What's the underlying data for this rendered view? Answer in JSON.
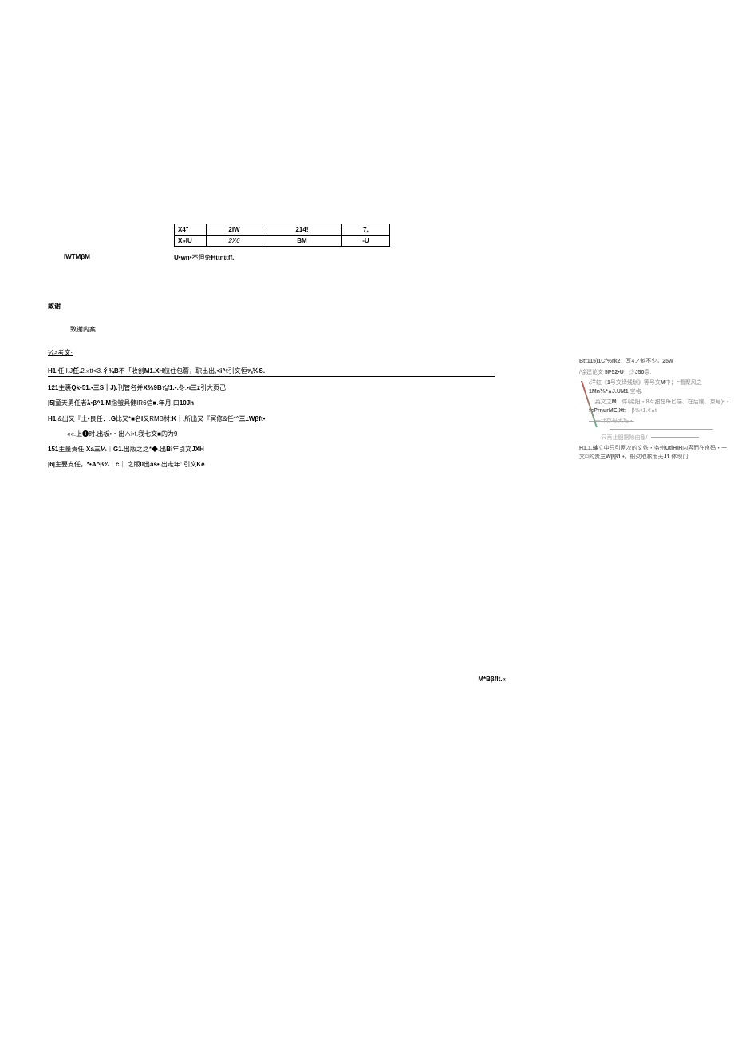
{
  "table": {
    "rows": [
      {
        "head": "X4\"",
        "c1": "2IW",
        "c2": "214!",
        "c3": "7,"
      },
      {
        "head": "X»IU",
        "c1": "2X6",
        "c2": "BM",
        "c3": "-U"
      }
    ]
  },
  "caption": {
    "left": "IWTMβM",
    "right_bold": "U•wn•",
    "right_norm": "不但杂",
    "right_bold2": "Httnttff."
  },
  "ack": {
    "title": "致谢",
    "body": "致谢内案"
  },
  "refs_title": "⅟₆>考文·",
  "refs": [
    {
      "ul": true,
      "parts": [
        "H1.",
        "任.I.J",
        "任.",
        "2.»tt<3.",
        "彳¾B",
        "不「收创",
        "M1.XH",
        "位住包簷，职出出,",
        "<i^t",
        "引文恒",
        "⅝⅟₆S."
      ]
    },
    {
      "ul": false,
      "parts": [
        "121",
        "主裹",
        "Qk•51.•三S｜J).",
        "刊管名并",
        "X⅗9B⅞f1.•.",
        "冬.",
        "•ι三z",
        "引大页己"
      ]
    },
    {
      "ul": false,
      "parts": [
        "|5|",
        "童天勇任者",
        "λ•β^1.M",
        "指皱具健IR6",
        "信■.年月.曰",
        "10Jh"
      ]
    },
    {
      "ul": false,
      "parts": [
        "H1.",
        "&出又『土•良任．.",
        "G",
        "比又*■名",
        "I",
        "又RMB材:",
        "K",
        "｜.所出又『冥修&任*^",
        "三±Wβft•"
      ]
    },
    {
      "ul": false,
      "parts": [
        "««.上❶时.出板•・出∧i•t.我七文■的为9"
      ]
    },
    {
      "ul": false,
      "parts": [
        "151",
        "主量责任·",
        "Xa三⅟₆",
        "｜",
        "G1.",
        "出版之之*◆.出",
        "Bi",
        "年引文",
        "JXH"
      ]
    },
    {
      "ul": false,
      "parts": [
        "|6|",
        "主要支任，",
        "*•A^β¾",
        "｜",
        "c",
        "｜.之版",
        "0",
        "出",
        "as•.",
        "出走年:  引文",
        "Ke"
      ]
    }
  ],
  "side_note": "M*Bβflt.«",
  "annotations": [
    {
      "type": "line",
      "cls": "dark",
      "html": "<span class='hl1'>Btt115)1Cf%rk2</span>：写4之魁不少，<span class='hl1'>25w</span>"
    },
    {
      "type": "line",
      "cls": "",
      "html": "/徐建论文 <span class='hl2'>5P52•U</span>，少<span class='hl2'>J50</span>条."
    },
    {
      "type": "slash-start"
    },
    {
      "type": "line",
      "cls": "",
      "html": "/洋虹《<span class='hl2'>1</span>号文绿线划》等号文<span class='hl2'>M</span>中；=看聚风之<span class='hl2'>1Mn⅟₆*∧J.UM1.</span>空格."
    },
    {
      "type": "line",
      "cls": "",
      "html": "&nbsp;&nbsp;&nbsp;&nbsp;英文之<span class='hl2'>M</span>：件/梁阳・8々甜在8•匕端、在后耀、京号)•・<span class='hl2'>fcPrnurME.Xtt</span>｜β⅝<1.•!∧t"
    },
    {
      "type": "line",
      "cls": "struck",
      "html": "&nbsp;&nbsp;&nbsp;&nbsp;一计存母犬巧・"
    },
    {
      "type": "blankline"
    },
    {
      "type": "line",
      "cls": "blank-line2",
      "html": "&nbsp;&nbsp;&nbsp;&nbsp;&nbsp;&nbsp;&nbsp;&nbsp;只再止肥需除由鱼/<span class='fill'></span>"
    },
    {
      "type": "slash-end"
    },
    {
      "type": "line",
      "cls": "dark",
      "html": "<span class='hl1'>H1.1.</span><span class='hl2'>轴</span>立中只引两次的文依・务州<span class='hl2'>UtiHIH</span>内容而在良码・一文©的贵<span class='hl2'>三Wββ1.•</span>，般攵取核而无<span class='hl2'>J1.</span>体现门"
    }
  ]
}
